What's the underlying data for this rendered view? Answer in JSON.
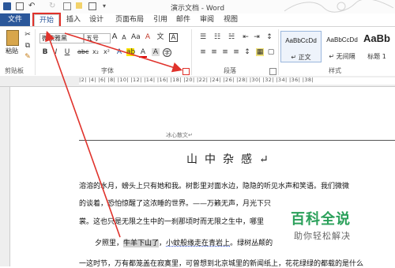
{
  "window": {
    "title": "演示文档 - Word"
  },
  "tabs": [
    "文件",
    "开始",
    "插入",
    "设计",
    "页面布局",
    "引用",
    "邮件",
    "审阅",
    "视图"
  ],
  "clipboard": {
    "paste_label": "粘贴",
    "group_label": "剪贴板"
  },
  "font": {
    "family_value": "微软雅黑",
    "size_value": "五号",
    "group_label": "字体"
  },
  "paragraph": {
    "group_label": "段落"
  },
  "styles": {
    "group_label": "样式",
    "items": [
      {
        "sample": "AaBbCcDd",
        "name": "↵ 正文"
      },
      {
        "sample": "AaBbCcDd",
        "name": "↵ 无间隔"
      },
      {
        "sample": "AaBb",
        "name": "标题 1"
      }
    ]
  },
  "ruler": {
    "marks": "|2| |4| |6| |8| |10| |12| |14| |16| |18| |20| |22| |24| |26| |28| |30| |32| |34| |36| |38|"
  },
  "document": {
    "header": "冰心散文↵",
    "title": "山中杂感↵",
    "p1_line1": "溶溶的水月，螃头上只有她和我。树影里对面水边，隐隐的听见水声和笑语。我们微微",
    "p1_line2": "的谈着，恐怕惊醒了这浓睡的世界。——万籁无声，月光下只",
    "p1_line3": "裳。这也只是无限之生中的一刹那顷时而无限之生中，哪里",
    "p2_pre": "夕照里，",
    "p2_hl": "牛羊下山了",
    "p2_mid": "，",
    "p2_ul": "小蚊般缘走在青岩上",
    "p2_post": "。绿树丛颠的",
    "p3_line": "一这时节，万有都笼盖在寂寞里，可曾想到北京城里的新闻纸上，花花绿绿的都载的是什么"
  },
  "watermark": {
    "title": "百科全说",
    "subtitle": "助你轻松解决"
  }
}
